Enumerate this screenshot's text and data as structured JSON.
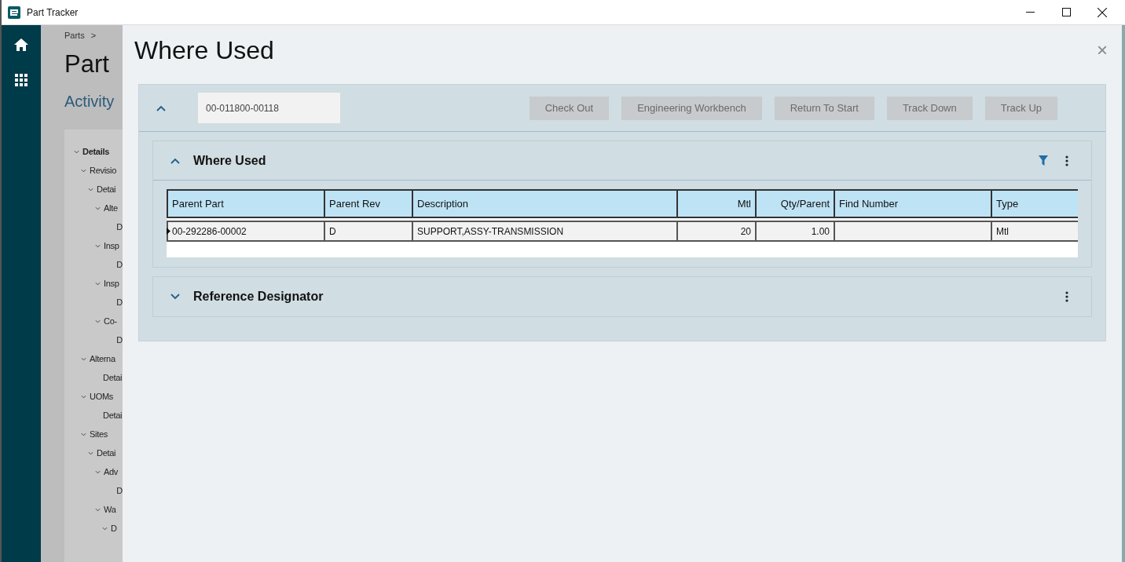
{
  "window": {
    "title": "Part Tracker"
  },
  "background": {
    "breadcrumb": "Parts",
    "breadcrumb_separator": ">",
    "title": "Part",
    "subtitle": "Activity",
    "tree": [
      {
        "label": "Details",
        "expanded": true,
        "children": [
          {
            "label": "Revisio",
            "expanded": true,
            "children": [
              {
                "label": "Detai",
                "expanded": true,
                "children": [
                  {
                    "label": "Alte",
                    "expanded": true,
                    "children": [
                      {
                        "label": "D"
                      }
                    ]
                  },
                  {
                    "label": "Insp",
                    "expanded": true,
                    "children": [
                      {
                        "label": "D"
                      }
                    ]
                  },
                  {
                    "label": "Insp",
                    "expanded": true,
                    "children": [
                      {
                        "label": "D"
                      }
                    ]
                  },
                  {
                    "label": "Co-",
                    "expanded": true,
                    "children": [
                      {
                        "label": "D"
                      }
                    ]
                  }
                ]
              }
            ]
          },
          {
            "label": "Alterna",
            "expanded": true,
            "children": [
              {
                "label": "Detai"
              }
            ]
          },
          {
            "label": "UOMs",
            "expanded": true,
            "children": [
              {
                "label": "Detai"
              }
            ]
          },
          {
            "label": "Sites",
            "expanded": true,
            "children": [
              {
                "label": "Detai",
                "expanded": true,
                "children": [
                  {
                    "label": "Adv",
                    "expanded": true,
                    "children": [
                      {
                        "label": "D"
                      }
                    ]
                  },
                  {
                    "label": "Wa",
                    "expanded": true,
                    "children": [
                      {
                        "label": "D",
                        "expanded": true
                      }
                    ]
                  }
                ]
              }
            ]
          }
        ]
      }
    ]
  },
  "dialog": {
    "title": "Where Used",
    "close": "×",
    "toolbar": {
      "expanded": true,
      "part_number": "00-011800-00118",
      "buttons": [
        {
          "label": "Check Out",
          "disabled": true
        },
        {
          "label": "Engineering Workbench",
          "disabled": true
        },
        {
          "label": "Return To Start",
          "disabled": true
        },
        {
          "label": "Track Down",
          "disabled": true
        },
        {
          "label": "Track Up",
          "disabled": true
        }
      ]
    },
    "panels": [
      {
        "title": "Where Used",
        "expanded": true,
        "filter": true,
        "table": {
          "columns": [
            {
              "label": "Parent Part",
              "numeric": false
            },
            {
              "label": "Parent Rev",
              "numeric": false
            },
            {
              "label": "Description",
              "numeric": false
            },
            {
              "label": "Mtl",
              "numeric": true
            },
            {
              "label": "Qty/Parent",
              "numeric": true
            },
            {
              "label": "Find Number",
              "numeric": false
            },
            {
              "label": "Type",
              "numeric": false
            }
          ],
          "rows": [
            {
              "selected": true,
              "cells": [
                "00-292286-00002",
                "D",
                "SUPPORT,ASSY-TRANSMISSION",
                "20",
                "1.00",
                "",
                "Mtl"
              ]
            }
          ]
        }
      },
      {
        "title": "Reference Designator",
        "expanded": false,
        "filter": false
      }
    ]
  }
}
